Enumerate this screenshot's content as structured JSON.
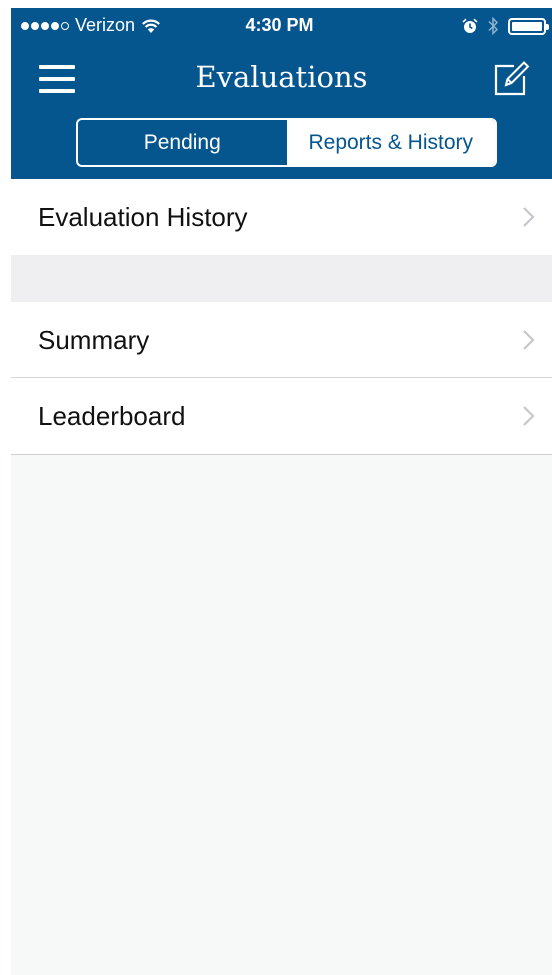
{
  "status_bar": {
    "carrier": "Verizon",
    "time": "4:30 PM",
    "signal_dots_filled": 4,
    "signal_dots_total": 5,
    "wifi_icon": "wifi-icon",
    "alarm_icon": "alarm-icon",
    "bluetooth_icon": "bluetooth-icon",
    "battery_icon": "battery-icon"
  },
  "nav": {
    "title": "Evaluations",
    "menu_icon": "hamburger-menu-icon",
    "compose_icon": "compose-icon"
  },
  "segments": [
    {
      "label": "Pending",
      "selected": false
    },
    {
      "label": "Reports & History",
      "selected": true
    }
  ],
  "list": {
    "group1": [
      {
        "label": "Evaluation History"
      }
    ],
    "group2": [
      {
        "label": "Summary"
      },
      {
        "label": "Leaderboard"
      }
    ]
  },
  "colors": {
    "brand": "#05568f",
    "background": "#f7f8f8",
    "separator": "#d6d6d8"
  }
}
